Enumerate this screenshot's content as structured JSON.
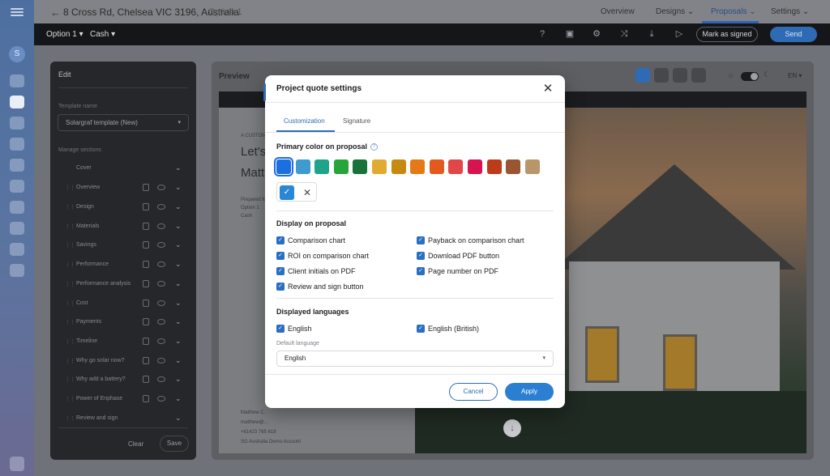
{
  "topbar": {
    "address": "8 Cross Rd, Chelsea VIC 3196, Australia",
    "option": "Option 1",
    "tabs": [
      {
        "label": "Overview"
      },
      {
        "label": "Designs"
      },
      {
        "label": "Proposals"
      },
      {
        "label": "Settings"
      }
    ]
  },
  "toolbar": {
    "option_select": "Option 1",
    "payment_select": "Cash",
    "mark_signed_label": "Mark as signed",
    "send_label": "Send"
  },
  "edit_panel": {
    "title": "Edit",
    "template_label": "Template name",
    "template_value": "Solargraf template (New)",
    "sections_label": "Manage sections",
    "sections": [
      {
        "label": "Cover"
      },
      {
        "label": "Overview"
      },
      {
        "label": "Design"
      },
      {
        "label": "Materials"
      },
      {
        "label": "Savings"
      },
      {
        "label": "Performance"
      },
      {
        "label": "Performance analysis"
      },
      {
        "label": "Cost"
      },
      {
        "label": "Payments"
      },
      {
        "label": "Timeline"
      },
      {
        "label": "Why go solar now?"
      },
      {
        "label": "Why add a battery?"
      },
      {
        "label": "Power of Enphase"
      },
      {
        "label": "Review and sign"
      }
    ],
    "clear_label": "Clear",
    "save_label": "Save"
  },
  "preview": {
    "title": "Preview",
    "language": "EN",
    "doc": {
      "kicker": "A CUSTOM",
      "heading_line1": "Let's",
      "heading_line2": "Matt",
      "line_a": "Prepared for",
      "line_b": "Option 1",
      "line_c": "Cash",
      "footer_a": "Matthew C.",
      "footer_b": "matthew@...",
      "footer_c": "+61423 765 618",
      "footer_d": "SG Australia Demo Account"
    }
  },
  "modal": {
    "title": "Project quote settings",
    "tabs": [
      {
        "label": "Customization"
      },
      {
        "label": "Signature"
      }
    ],
    "primary_color_heading": "Primary color on proposal",
    "colors": [
      "#1c6fe0",
      "#3d9bd0",
      "#1fa38a",
      "#27a53a",
      "#177338",
      "#e0ab2e",
      "#c78a10",
      "#e57916",
      "#e35a1e",
      "#e24646",
      "#d7144f",
      "#bd3b18",
      "#9a5630",
      "#b8966a"
    ],
    "selected_color": "#2a87d6",
    "display_heading": "Display on proposal",
    "display_options": [
      {
        "label": "Comparison chart",
        "checked": true
      },
      {
        "label": "Payback on comparison chart",
        "checked": true
      },
      {
        "label": "ROI on comparison chart",
        "checked": true
      },
      {
        "label": "Download PDF button",
        "checked": true
      },
      {
        "label": "Client initials on PDF",
        "checked": true
      },
      {
        "label": "Page number on PDF",
        "checked": true
      },
      {
        "label": "Review and sign button",
        "checked": true
      }
    ],
    "languages_heading": "Displayed languages",
    "languages": [
      {
        "label": "English",
        "checked": true
      },
      {
        "label": "English (British)",
        "checked": true
      }
    ],
    "default_language_label": "Default language",
    "default_language_value": "English",
    "cancel_label": "Cancel",
    "apply_label": "Apply"
  }
}
